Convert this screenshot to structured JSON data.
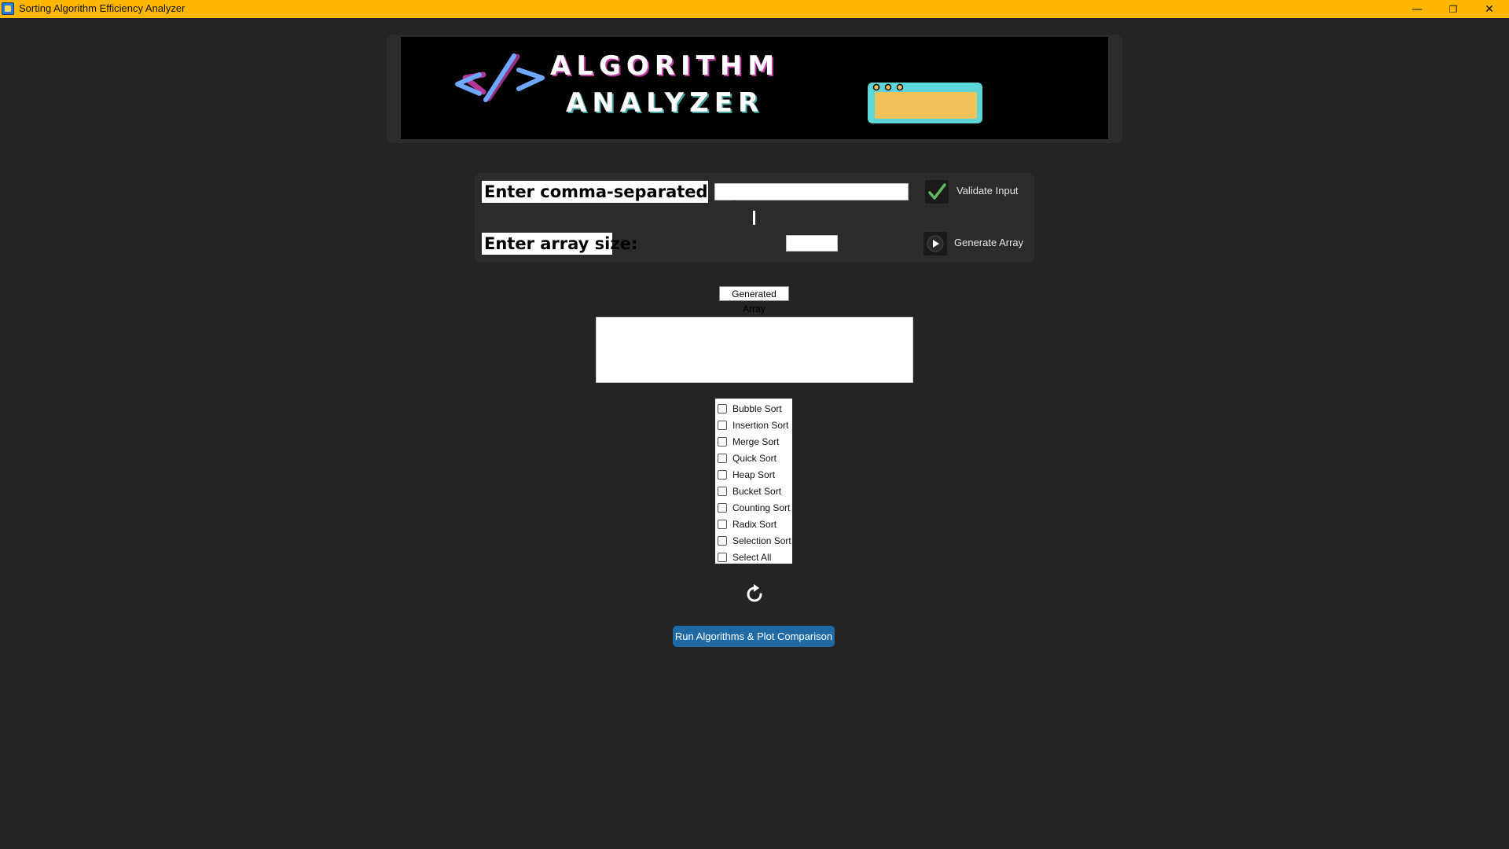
{
  "window": {
    "title": "Sorting Algorithm Efficiency Analyzer",
    "controls": {
      "minimize": "—",
      "maximize": "❐",
      "close": "✕"
    }
  },
  "banner": {
    "line1": "ALGORITHM",
    "line2": "ANALYZER",
    "code_symbol": "</>"
  },
  "input_panel": {
    "csv_label": "Enter comma-separated input:",
    "csv_value": "",
    "size_label": "Enter array size:",
    "size_value": "",
    "validate_label": "Validate Input",
    "generate_label": "Generate Array"
  },
  "generated": {
    "label": "Generated Array",
    "value": ""
  },
  "algorithms": [
    {
      "label": "Bubble Sort",
      "checked": false
    },
    {
      "label": "Insertion Sort",
      "checked": false
    },
    {
      "label": "Merge Sort",
      "checked": false
    },
    {
      "label": "Quick Sort",
      "checked": false
    },
    {
      "label": "Heap Sort",
      "checked": false
    },
    {
      "label": "Bucket Sort",
      "checked": false
    },
    {
      "label": "Counting Sort",
      "checked": false
    },
    {
      "label": "Radix Sort",
      "checked": false
    },
    {
      "label": "Selection Sort",
      "checked": false
    },
    {
      "label": "Select All",
      "checked": false
    }
  ],
  "run_button": "Run Algorithms & Plot Comparison",
  "colors": {
    "titlebar": "#ffb703",
    "background": "#242424",
    "panel": "#2b2b2b",
    "accent": "#1f6aa5",
    "banner_pink": "#ff4fd8",
    "banner_cyan": "#5cd6d6",
    "banner_blue": "#6fa8ff",
    "banner_yellow": "#f2c25a"
  }
}
